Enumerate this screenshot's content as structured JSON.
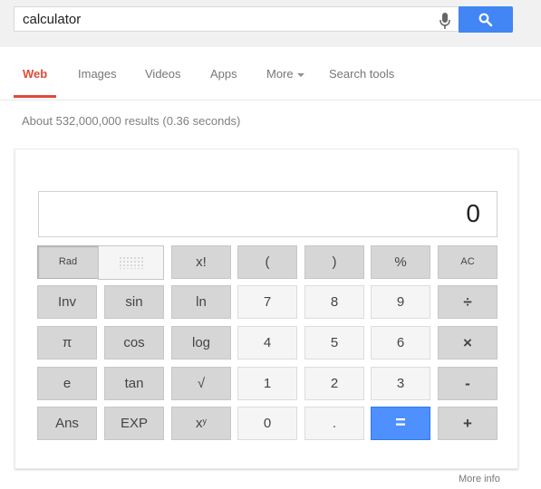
{
  "search": {
    "query": "calculator",
    "mic_icon": "microphone-icon",
    "search_icon": "magnifier-icon",
    "brand_color": "#4285f4"
  },
  "tabs": [
    {
      "label": "Web",
      "active": true
    },
    {
      "label": "Images"
    },
    {
      "label": "Videos"
    },
    {
      "label": "Apps"
    },
    {
      "label": "More"
    },
    {
      "label": "Search tools"
    }
  ],
  "stats": "About 532,000,000 results (0.36 seconds)",
  "calculator": {
    "display": "0",
    "mode_rad": "Rad",
    "mode_deg_icon": "dotted-grid-icon",
    "keys": {
      "fact": "x!",
      "lparen": "(",
      "rparen": ")",
      "percent": "%",
      "ac": "AC",
      "inv": "Inv",
      "sin": "sin",
      "ln": "ln",
      "k7": "7",
      "k8": "8",
      "k9": "9",
      "div": "÷",
      "pi": "π",
      "cos": "cos",
      "log": "log",
      "k4": "4",
      "k5": "5",
      "k6": "6",
      "mul": "×",
      "e": "e",
      "tan": "tan",
      "sqrt": "√",
      "k1": "1",
      "k2": "2",
      "k3": "3",
      "sub": "-",
      "ans": "Ans",
      "exp": "EXP",
      "pow_base": "x",
      "pow_exp": "y",
      "k0": "0",
      "dot": ".",
      "eq": "=",
      "add": "+"
    },
    "accent_color": "#4d90fe"
  },
  "more_info": "More info"
}
